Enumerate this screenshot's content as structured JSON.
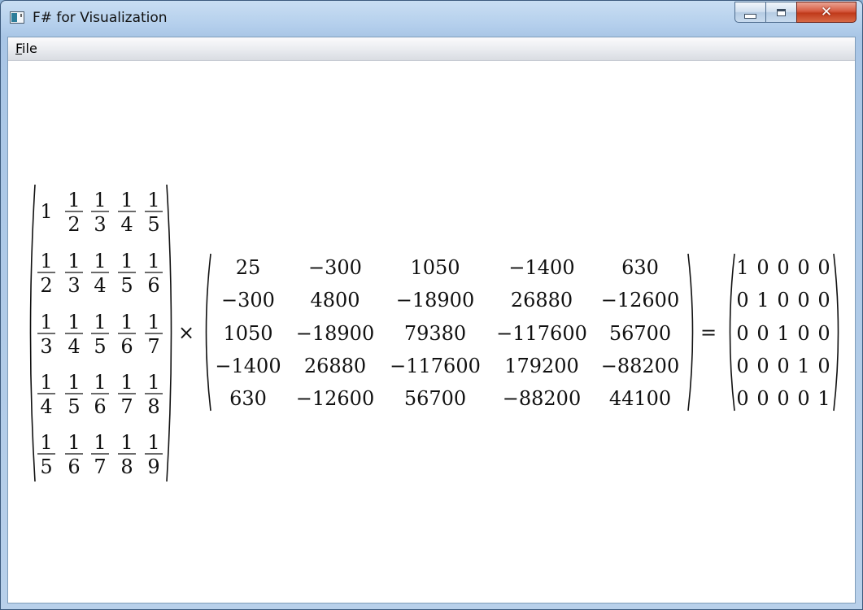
{
  "window": {
    "title": "F# for Visualization",
    "icon": "app-window-icon",
    "controls": [
      "minimize-icon",
      "maximize-icon",
      "close-icon"
    ]
  },
  "menu": {
    "items": [
      {
        "label": "File",
        "accelerator": "F"
      }
    ]
  },
  "equation": {
    "operator_times": "×",
    "operator_equals": "=",
    "matrix_a": {
      "rows": [
        [
          "1",
          "1/2",
          "1/3",
          "1/4",
          "1/5"
        ],
        [
          "1/2",
          "1/3",
          "1/4",
          "1/5",
          "1/6"
        ],
        [
          "1/3",
          "1/4",
          "1/5",
          "1/6",
          "1/7"
        ],
        [
          "1/4",
          "1/5",
          "1/6",
          "1/7",
          "1/8"
        ],
        [
          "1/5",
          "1/6",
          "1/7",
          "1/8",
          "1/9"
        ]
      ]
    },
    "matrix_b": {
      "rows": [
        [
          "25",
          "−300",
          "1050",
          "−1400",
          "630"
        ],
        [
          "−300",
          "4800",
          "−18900",
          "26880",
          "−12600"
        ],
        [
          "1050",
          "−18900",
          "79380",
          "−117600",
          "56700"
        ],
        [
          "−1400",
          "26880",
          "−117600",
          "179200",
          "−88200"
        ],
        [
          "630",
          "−12600",
          "56700",
          "−88200",
          "44100"
        ]
      ]
    },
    "matrix_c": {
      "rows": [
        [
          "1",
          "0",
          "0",
          "0",
          "0"
        ],
        [
          "0",
          "1",
          "0",
          "0",
          "0"
        ],
        [
          "0",
          "0",
          "1",
          "0",
          "0"
        ],
        [
          "0",
          "0",
          "0",
          "1",
          "0"
        ],
        [
          "0",
          "0",
          "0",
          "0",
          "1"
        ]
      ]
    }
  }
}
